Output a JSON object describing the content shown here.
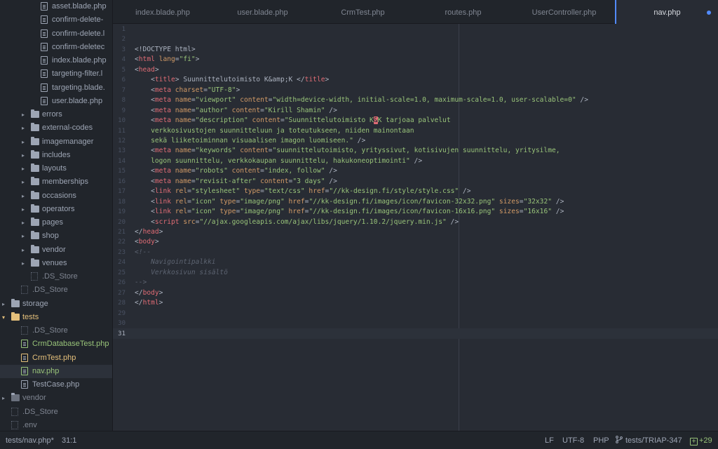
{
  "sidebar": {
    "items": [
      {
        "label": "asset.blade.php",
        "kind": "file",
        "depth": 3
      },
      {
        "label": "confirm-delete-",
        "kind": "file",
        "depth": 3
      },
      {
        "label": "confirm-delete.l",
        "kind": "file",
        "depth": 3
      },
      {
        "label": "confirm-deletec",
        "kind": "file",
        "depth": 3
      },
      {
        "label": "index.blade.php",
        "kind": "file",
        "depth": 3
      },
      {
        "label": "targeting-filter.l",
        "kind": "file",
        "depth": 3
      },
      {
        "label": "targeting.blade.",
        "kind": "file",
        "depth": 3
      },
      {
        "label": "user.blade.php",
        "kind": "file",
        "depth": 3
      },
      {
        "label": "errors",
        "kind": "folder",
        "depth": 2
      },
      {
        "label": "external-codes",
        "kind": "folder",
        "depth": 2
      },
      {
        "label": "imagemanager",
        "kind": "folder",
        "depth": 2
      },
      {
        "label": "includes",
        "kind": "folder",
        "depth": 2
      },
      {
        "label": "layouts",
        "kind": "folder",
        "depth": 2
      },
      {
        "label": "memberships",
        "kind": "folder",
        "depth": 2
      },
      {
        "label": "occasions",
        "kind": "folder",
        "depth": 2
      },
      {
        "label": "operators",
        "kind": "folder",
        "depth": 2
      },
      {
        "label": "pages",
        "kind": "folder",
        "depth": 2
      },
      {
        "label": "shop",
        "kind": "folder",
        "depth": 2
      },
      {
        "label": "vendor",
        "kind": "folder",
        "depth": 2
      },
      {
        "label": "venues",
        "kind": "folder",
        "depth": 2
      },
      {
        "label": ".DS_Store",
        "kind": "dotfile",
        "depth": 2
      },
      {
        "label": ".DS_Store",
        "kind": "dotfile",
        "depth": 1
      },
      {
        "label": "storage",
        "kind": "folder",
        "depth": 0
      },
      {
        "label": "tests",
        "kind": "folder-open",
        "depth": 0
      },
      {
        "label": ".DS_Store",
        "kind": "dotfile",
        "depth": 1
      },
      {
        "label": "CrmDatabaseTest.php",
        "kind": "file-new",
        "depth": 1
      },
      {
        "label": "CrmTest.php",
        "kind": "file-modified",
        "depth": 1
      },
      {
        "label": "nav.php",
        "kind": "file-new-selected",
        "depth": 1
      },
      {
        "label": "TestCase.php",
        "kind": "file",
        "depth": 1
      },
      {
        "label": "vendor",
        "kind": "folder-dim",
        "depth": 0
      },
      {
        "label": ".DS_Store",
        "kind": "dotfile",
        "depth": 0
      },
      {
        "label": ".env",
        "kind": "dotfile",
        "depth": 0
      }
    ]
  },
  "tabs": [
    {
      "label": "index.blade.php",
      "active": false
    },
    {
      "label": "user.blade.php",
      "active": false
    },
    {
      "label": "CrmTest.php",
      "active": false
    },
    {
      "label": "routes.php",
      "active": false
    },
    {
      "label": "UserController.php",
      "active": false
    },
    {
      "label": "nav.php",
      "active": true,
      "modified": true
    }
  ],
  "editor": {
    "current_line": 31,
    "lines": [
      {
        "n": "1",
        "tokens": []
      },
      {
        "n": "2",
        "tokens": []
      },
      {
        "n": "3",
        "tokens": [
          {
            "t": "<!DOCTYPE html>",
            "c": "plain"
          }
        ]
      },
      {
        "n": "4",
        "tokens": [
          {
            "t": "<",
            "c": "bracket"
          },
          {
            "t": "html",
            "c": "tag"
          },
          {
            "t": " lang",
            "c": "attr"
          },
          {
            "t": "=",
            "c": "plain"
          },
          {
            "t": "\"fi\"",
            "c": "str"
          },
          {
            "t": ">",
            "c": "bracket"
          }
        ]
      },
      {
        "n": "5",
        "tokens": [
          {
            "t": "<",
            "c": "bracket"
          },
          {
            "t": "head",
            "c": "tag"
          },
          {
            "t": ">",
            "c": "bracket"
          }
        ]
      },
      {
        "n": "6",
        "tokens": [
          {
            "t": "    <",
            "c": "bracket"
          },
          {
            "t": "title",
            "c": "tag"
          },
          {
            "t": "> Suunnittelutoimisto K&amp;K </",
            "c": "plain"
          },
          {
            "t": "title",
            "c": "tag"
          },
          {
            "t": ">",
            "c": "bracket"
          }
        ]
      },
      {
        "n": "7",
        "tokens": [
          {
            "t": "    <",
            "c": "bracket"
          },
          {
            "t": "meta",
            "c": "tag"
          },
          {
            "t": " charset",
            "c": "attr"
          },
          {
            "t": "=",
            "c": "plain"
          },
          {
            "t": "\"UTF-8\"",
            "c": "str"
          },
          {
            "t": ">",
            "c": "bracket"
          }
        ]
      },
      {
        "n": "8",
        "tokens": [
          {
            "t": "    <",
            "c": "bracket"
          },
          {
            "t": "meta",
            "c": "tag"
          },
          {
            "t": " name",
            "c": "attr"
          },
          {
            "t": "=",
            "c": "plain"
          },
          {
            "t": "\"viewport\"",
            "c": "str"
          },
          {
            "t": " content",
            "c": "attr"
          },
          {
            "t": "=",
            "c": "plain"
          },
          {
            "t": "\"width=device-width, initial-scale=1.0, maximum-scale=1.0, user-scalable=0\"",
            "c": "str"
          },
          {
            "t": " />",
            "c": "bracket"
          }
        ]
      },
      {
        "n": "9",
        "tokens": [
          {
            "t": "    <",
            "c": "bracket"
          },
          {
            "t": "meta",
            "c": "tag"
          },
          {
            "t": " name",
            "c": "attr"
          },
          {
            "t": "=",
            "c": "plain"
          },
          {
            "t": "\"author\"",
            "c": "str"
          },
          {
            "t": " content",
            "c": "attr"
          },
          {
            "t": "=",
            "c": "plain"
          },
          {
            "t": "\"Kirill Shamin\"",
            "c": "str"
          },
          {
            "t": " />",
            "c": "bracket"
          }
        ]
      },
      {
        "n": "10",
        "tokens": [
          {
            "t": "    <",
            "c": "bracket"
          },
          {
            "t": "meta",
            "c": "tag"
          },
          {
            "t": " name",
            "c": "attr"
          },
          {
            "t": "=",
            "c": "plain"
          },
          {
            "t": "\"description\"",
            "c": "str"
          },
          {
            "t": " content",
            "c": "attr"
          },
          {
            "t": "=",
            "c": "plain"
          },
          {
            "t": "\"Suunnittelutoimisto K",
            "c": "str"
          },
          {
            "t": "&",
            "c": "hl"
          },
          {
            "t": "K tarjoaa palvelut",
            "c": "str"
          }
        ]
      },
      {
        "n": "11",
        "tokens": [
          {
            "t": "    verkkosivustojen suunnitteluun ja toteutukseen, niiden mainontaan",
            "c": "str"
          }
        ]
      },
      {
        "n": "12",
        "tokens": [
          {
            "t": "    sekä liiketoiminnan visuaalisen imagon luomiseen.\"",
            "c": "str"
          },
          {
            "t": " />",
            "c": "bracket"
          }
        ]
      },
      {
        "n": "13",
        "tokens": [
          {
            "t": "    <",
            "c": "bracket"
          },
          {
            "t": "meta",
            "c": "tag"
          },
          {
            "t": " name",
            "c": "attr"
          },
          {
            "t": "=",
            "c": "plain"
          },
          {
            "t": "\"keywords\"",
            "c": "str"
          },
          {
            "t": " content",
            "c": "attr"
          },
          {
            "t": "=",
            "c": "plain"
          },
          {
            "t": "\"suunnittelutoimisto, yrityssivut, kotisivujen suunnittelu, yritysilme,",
            "c": "str"
          }
        ]
      },
      {
        "n": "14",
        "tokens": [
          {
            "t": "    logon suunnittelu, verkkokaupan suunnittelu, hakukoneoptimointi\"",
            "c": "str"
          },
          {
            "t": " />",
            "c": "bracket"
          }
        ]
      },
      {
        "n": "15",
        "tokens": [
          {
            "t": "    <",
            "c": "bracket"
          },
          {
            "t": "meta",
            "c": "tag"
          },
          {
            "t": " name",
            "c": "attr"
          },
          {
            "t": "=",
            "c": "plain"
          },
          {
            "t": "\"robots\"",
            "c": "str"
          },
          {
            "t": " content",
            "c": "attr"
          },
          {
            "t": "=",
            "c": "plain"
          },
          {
            "t": "\"index, follow\"",
            "c": "str"
          },
          {
            "t": " />",
            "c": "bracket"
          }
        ]
      },
      {
        "n": "16",
        "tokens": [
          {
            "t": "    <",
            "c": "bracket"
          },
          {
            "t": "meta",
            "c": "tag"
          },
          {
            "t": " name",
            "c": "attr"
          },
          {
            "t": "=",
            "c": "plain"
          },
          {
            "t": "\"revisit-after\"",
            "c": "str"
          },
          {
            "t": " content",
            "c": "attr"
          },
          {
            "t": "=",
            "c": "plain"
          },
          {
            "t": "\"3 days\"",
            "c": "str"
          },
          {
            "t": " />",
            "c": "bracket"
          }
        ]
      },
      {
        "n": "17",
        "tokens": [
          {
            "t": "    <",
            "c": "bracket"
          },
          {
            "t": "link",
            "c": "tag"
          },
          {
            "t": " rel",
            "c": "attr"
          },
          {
            "t": "=",
            "c": "plain"
          },
          {
            "t": "\"stylesheet\"",
            "c": "str"
          },
          {
            "t": " type",
            "c": "attr"
          },
          {
            "t": "=",
            "c": "plain"
          },
          {
            "t": "\"text/css\"",
            "c": "str"
          },
          {
            "t": " href",
            "c": "attr"
          },
          {
            "t": "=",
            "c": "plain"
          },
          {
            "t": "\"//kk-design.fi/style/style.css\"",
            "c": "str"
          },
          {
            "t": " />",
            "c": "bracket"
          }
        ]
      },
      {
        "n": "18",
        "tokens": [
          {
            "t": "    <",
            "c": "bracket"
          },
          {
            "t": "link",
            "c": "tag"
          },
          {
            "t": " rel",
            "c": "attr"
          },
          {
            "t": "=",
            "c": "plain"
          },
          {
            "t": "\"icon\"",
            "c": "str"
          },
          {
            "t": " type",
            "c": "attr"
          },
          {
            "t": "=",
            "c": "plain"
          },
          {
            "t": "\"image/png\"",
            "c": "str"
          },
          {
            "t": " href",
            "c": "attr"
          },
          {
            "t": "=",
            "c": "plain"
          },
          {
            "t": "\"//kk-design.fi/images/icon/favicon-32x32.png\"",
            "c": "str"
          },
          {
            "t": " sizes",
            "c": "attr"
          },
          {
            "t": "=",
            "c": "plain"
          },
          {
            "t": "\"32x32\"",
            "c": "str"
          },
          {
            "t": " />",
            "c": "bracket"
          }
        ]
      },
      {
        "n": "19",
        "tokens": [
          {
            "t": "    <",
            "c": "bracket"
          },
          {
            "t": "link",
            "c": "tag"
          },
          {
            "t": " rel",
            "c": "attr"
          },
          {
            "t": "=",
            "c": "plain"
          },
          {
            "t": "\"icon\"",
            "c": "str"
          },
          {
            "t": " type",
            "c": "attr"
          },
          {
            "t": "=",
            "c": "plain"
          },
          {
            "t": "\"image/png\"",
            "c": "str"
          },
          {
            "t": " href",
            "c": "attr"
          },
          {
            "t": "=",
            "c": "plain"
          },
          {
            "t": "\"//kk-design.fi/images/icon/favicon-16x16.png\"",
            "c": "str"
          },
          {
            "t": " sizes",
            "c": "attr"
          },
          {
            "t": "=",
            "c": "plain"
          },
          {
            "t": "\"16x16\"",
            "c": "str"
          },
          {
            "t": " />",
            "c": "bracket"
          }
        ]
      },
      {
        "n": "20",
        "tokens": [
          {
            "t": "    <",
            "c": "bracket"
          },
          {
            "t": "script",
            "c": "tag"
          },
          {
            "t": " src",
            "c": "attr"
          },
          {
            "t": "=",
            "c": "plain"
          },
          {
            "t": "\"//ajax.googleapis.com/ajax/libs/jquery/1.10.2/jquery.min.js\"",
            "c": "str"
          },
          {
            "t": " />",
            "c": "bracket"
          }
        ]
      },
      {
        "n": "21",
        "tokens": [
          {
            "t": "</",
            "c": "bracket"
          },
          {
            "t": "head",
            "c": "tag"
          },
          {
            "t": ">",
            "c": "bracket"
          }
        ]
      },
      {
        "n": "22",
        "tokens": [
          {
            "t": "<",
            "c": "bracket"
          },
          {
            "t": "body",
            "c": "tag"
          },
          {
            "t": ">",
            "c": "bracket"
          }
        ]
      },
      {
        "n": "23",
        "tokens": [
          {
            "t": "<!--",
            "c": "cmt"
          }
        ]
      },
      {
        "n": "24",
        "tokens": [
          {
            "t": "    Navigointipalkki",
            "c": "cmt"
          }
        ]
      },
      {
        "n": "25",
        "tokens": [
          {
            "t": "    Verkkosivun sisältö",
            "c": "cmt"
          }
        ]
      },
      {
        "n": "26",
        "tokens": [
          {
            "t": "-->",
            "c": "cmt"
          }
        ]
      },
      {
        "n": "27",
        "tokens": [
          {
            "t": "</",
            "c": "bracket"
          },
          {
            "t": "body",
            "c": "tag"
          },
          {
            "t": ">",
            "c": "bracket"
          }
        ]
      },
      {
        "n": "28",
        "tokens": [
          {
            "t": "</",
            "c": "bracket"
          },
          {
            "t": "html",
            "c": "tag"
          },
          {
            "t": ">",
            "c": "bracket"
          }
        ]
      },
      {
        "n": "29",
        "tokens": []
      },
      {
        "n": "30",
        "tokens": []
      },
      {
        "n": "31",
        "tokens": []
      }
    ]
  },
  "statusbar": {
    "file_path": "tests/nav.php*",
    "cursor": "31:1",
    "line_ending": "LF",
    "encoding": "UTF-8",
    "grammar": "PHP",
    "branch": "tests/TRIAP-347",
    "git_plus_icon": "+",
    "git_changes": "+29"
  },
  "colors": {
    "accent": "#528bff",
    "tag": "#e06c75",
    "attr": "#d19a66",
    "string": "#98c379",
    "comment": "#5c6370",
    "folder_open": "#e5c07b"
  }
}
